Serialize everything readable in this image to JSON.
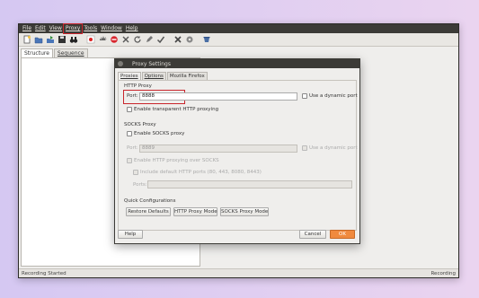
{
  "menubar": {
    "items": [
      "File",
      "Edit",
      "View",
      "Proxy",
      "Tools",
      "Window",
      "Help"
    ]
  },
  "toolbar": {
    "icons": [
      "new-icon",
      "open-icon",
      "export-icon",
      "save-icon",
      "binoculars-icon",
      "record-icon",
      "stop-icon",
      "broom-icon",
      "delete-icon",
      "refresh-icon",
      "edit-icon",
      "check-icon",
      "tools-icon",
      "settings-icon",
      "help-icon"
    ]
  },
  "left_panel": {
    "tabs": [
      "Structure",
      "Sequence"
    ]
  },
  "statusbar": {
    "left": "Recording Started",
    "right": "Recording"
  },
  "dialog": {
    "title": "Proxy Settings",
    "tabs": [
      "Proxies",
      "Options",
      "Mozilla Firefox"
    ],
    "http_proxy": {
      "label": "HTTP Proxy",
      "port_label": "Port:",
      "port_value": "8888",
      "dynamic_port_label": "Use a dynamic port",
      "transparent_label": "Enable transparent HTTP proxying"
    },
    "socks_proxy": {
      "label": "SOCKS Proxy",
      "enable_label": "Enable SOCKS proxy",
      "port_label": "Port:",
      "port_value": "8889",
      "dynamic_port_label": "Use a dynamic port",
      "http_over_socks_label": "Enable HTTP proxying over SOCKS",
      "include_default_label": "Include default HTTP ports (80, 443, 8080, 8443)",
      "ports_label": "Ports:"
    },
    "quick_config": {
      "label": "Quick Configurations",
      "restore_label": "Restore Defaults",
      "http_mode_label": "HTTP Proxy Mode",
      "socks_mode_label": "SOCKS Proxy Mode"
    },
    "help_label": "Help",
    "cancel_label": "Cancel",
    "ok_label": "OK"
  },
  "colors": {
    "accent": "#f08a3e",
    "highlight": "#c9252c",
    "titlebar": "#3c3b37"
  }
}
